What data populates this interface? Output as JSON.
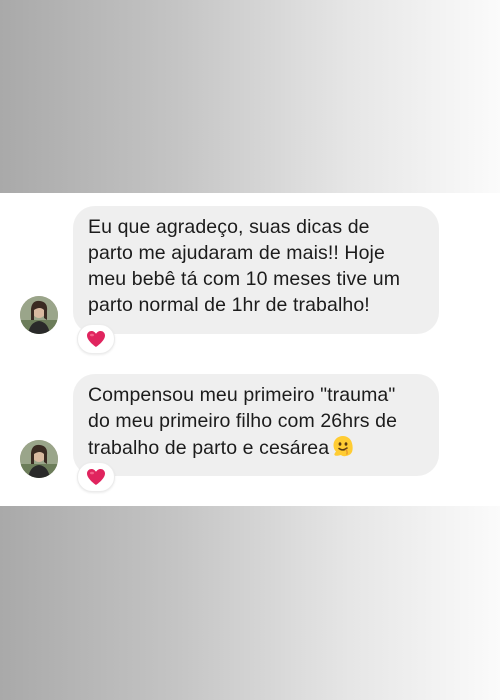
{
  "messages": [
    {
      "text": "Eu que agradeço, suas dicas de\nparto me ajudaram de mais!! Hoje\nmeu bebê tá com 10 meses tive um\nparto normal de 1hr de trabalho!",
      "reaction": "heart-icon",
      "avatar": "avatar"
    },
    {
      "text": "Compensou meu primeiro \"trauma\"\ndo meu primeiro filho com 26hrs de\ntrabalho de parto e cesárea",
      "emoji": "melting-face-icon",
      "reaction": "heart-icon",
      "avatar": "avatar"
    }
  ],
  "colors": {
    "bubble": "#efefef",
    "text": "#1c1c1c",
    "heart": "#e0245e",
    "panel": "#ffffff"
  }
}
